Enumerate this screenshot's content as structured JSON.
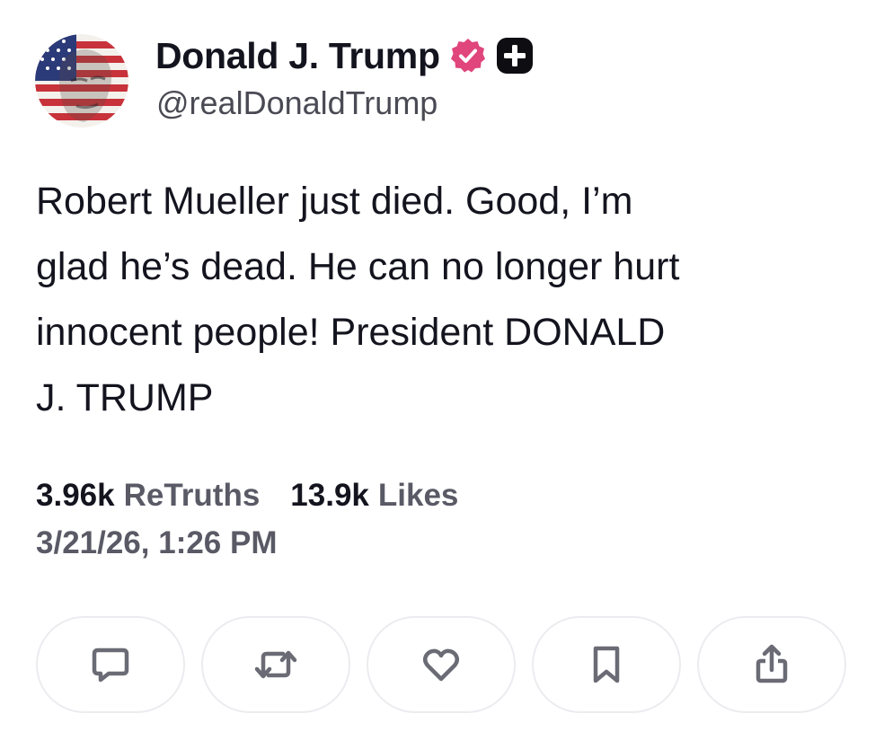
{
  "post": {
    "author": {
      "display_name": "Donald J. Trump",
      "handle": "@realDonaldTrump",
      "avatar_icon": "avatar-flag-portrait",
      "verified_icon": "verified-badge-icon",
      "verified_color": "#e0457b",
      "plus_icon": "plus-badge-icon"
    },
    "text": "Robert Mueller just died. Good, I’m\nglad he’s dead. He can no longer hurt\ninnocent people! President DONALD\nJ. TRUMP",
    "stats": {
      "retruths_count": "3.96k",
      "retruths_label": "ReTruths",
      "likes_count": "13.9k",
      "likes_label": "Likes"
    },
    "timestamp": "3/21/26, 1:26 PM",
    "actions": [
      {
        "name": "reply",
        "icon": "comment-icon"
      },
      {
        "name": "retruth",
        "icon": "repost-icon"
      },
      {
        "name": "like",
        "icon": "heart-icon"
      },
      {
        "name": "bookmark",
        "icon": "bookmark-icon"
      },
      {
        "name": "share",
        "icon": "share-icon"
      }
    ],
    "colors": {
      "text_primary": "#14141f",
      "text_secondary": "#5a5a66",
      "icon_gray": "#6b6b75",
      "button_border": "#ececf0"
    }
  }
}
